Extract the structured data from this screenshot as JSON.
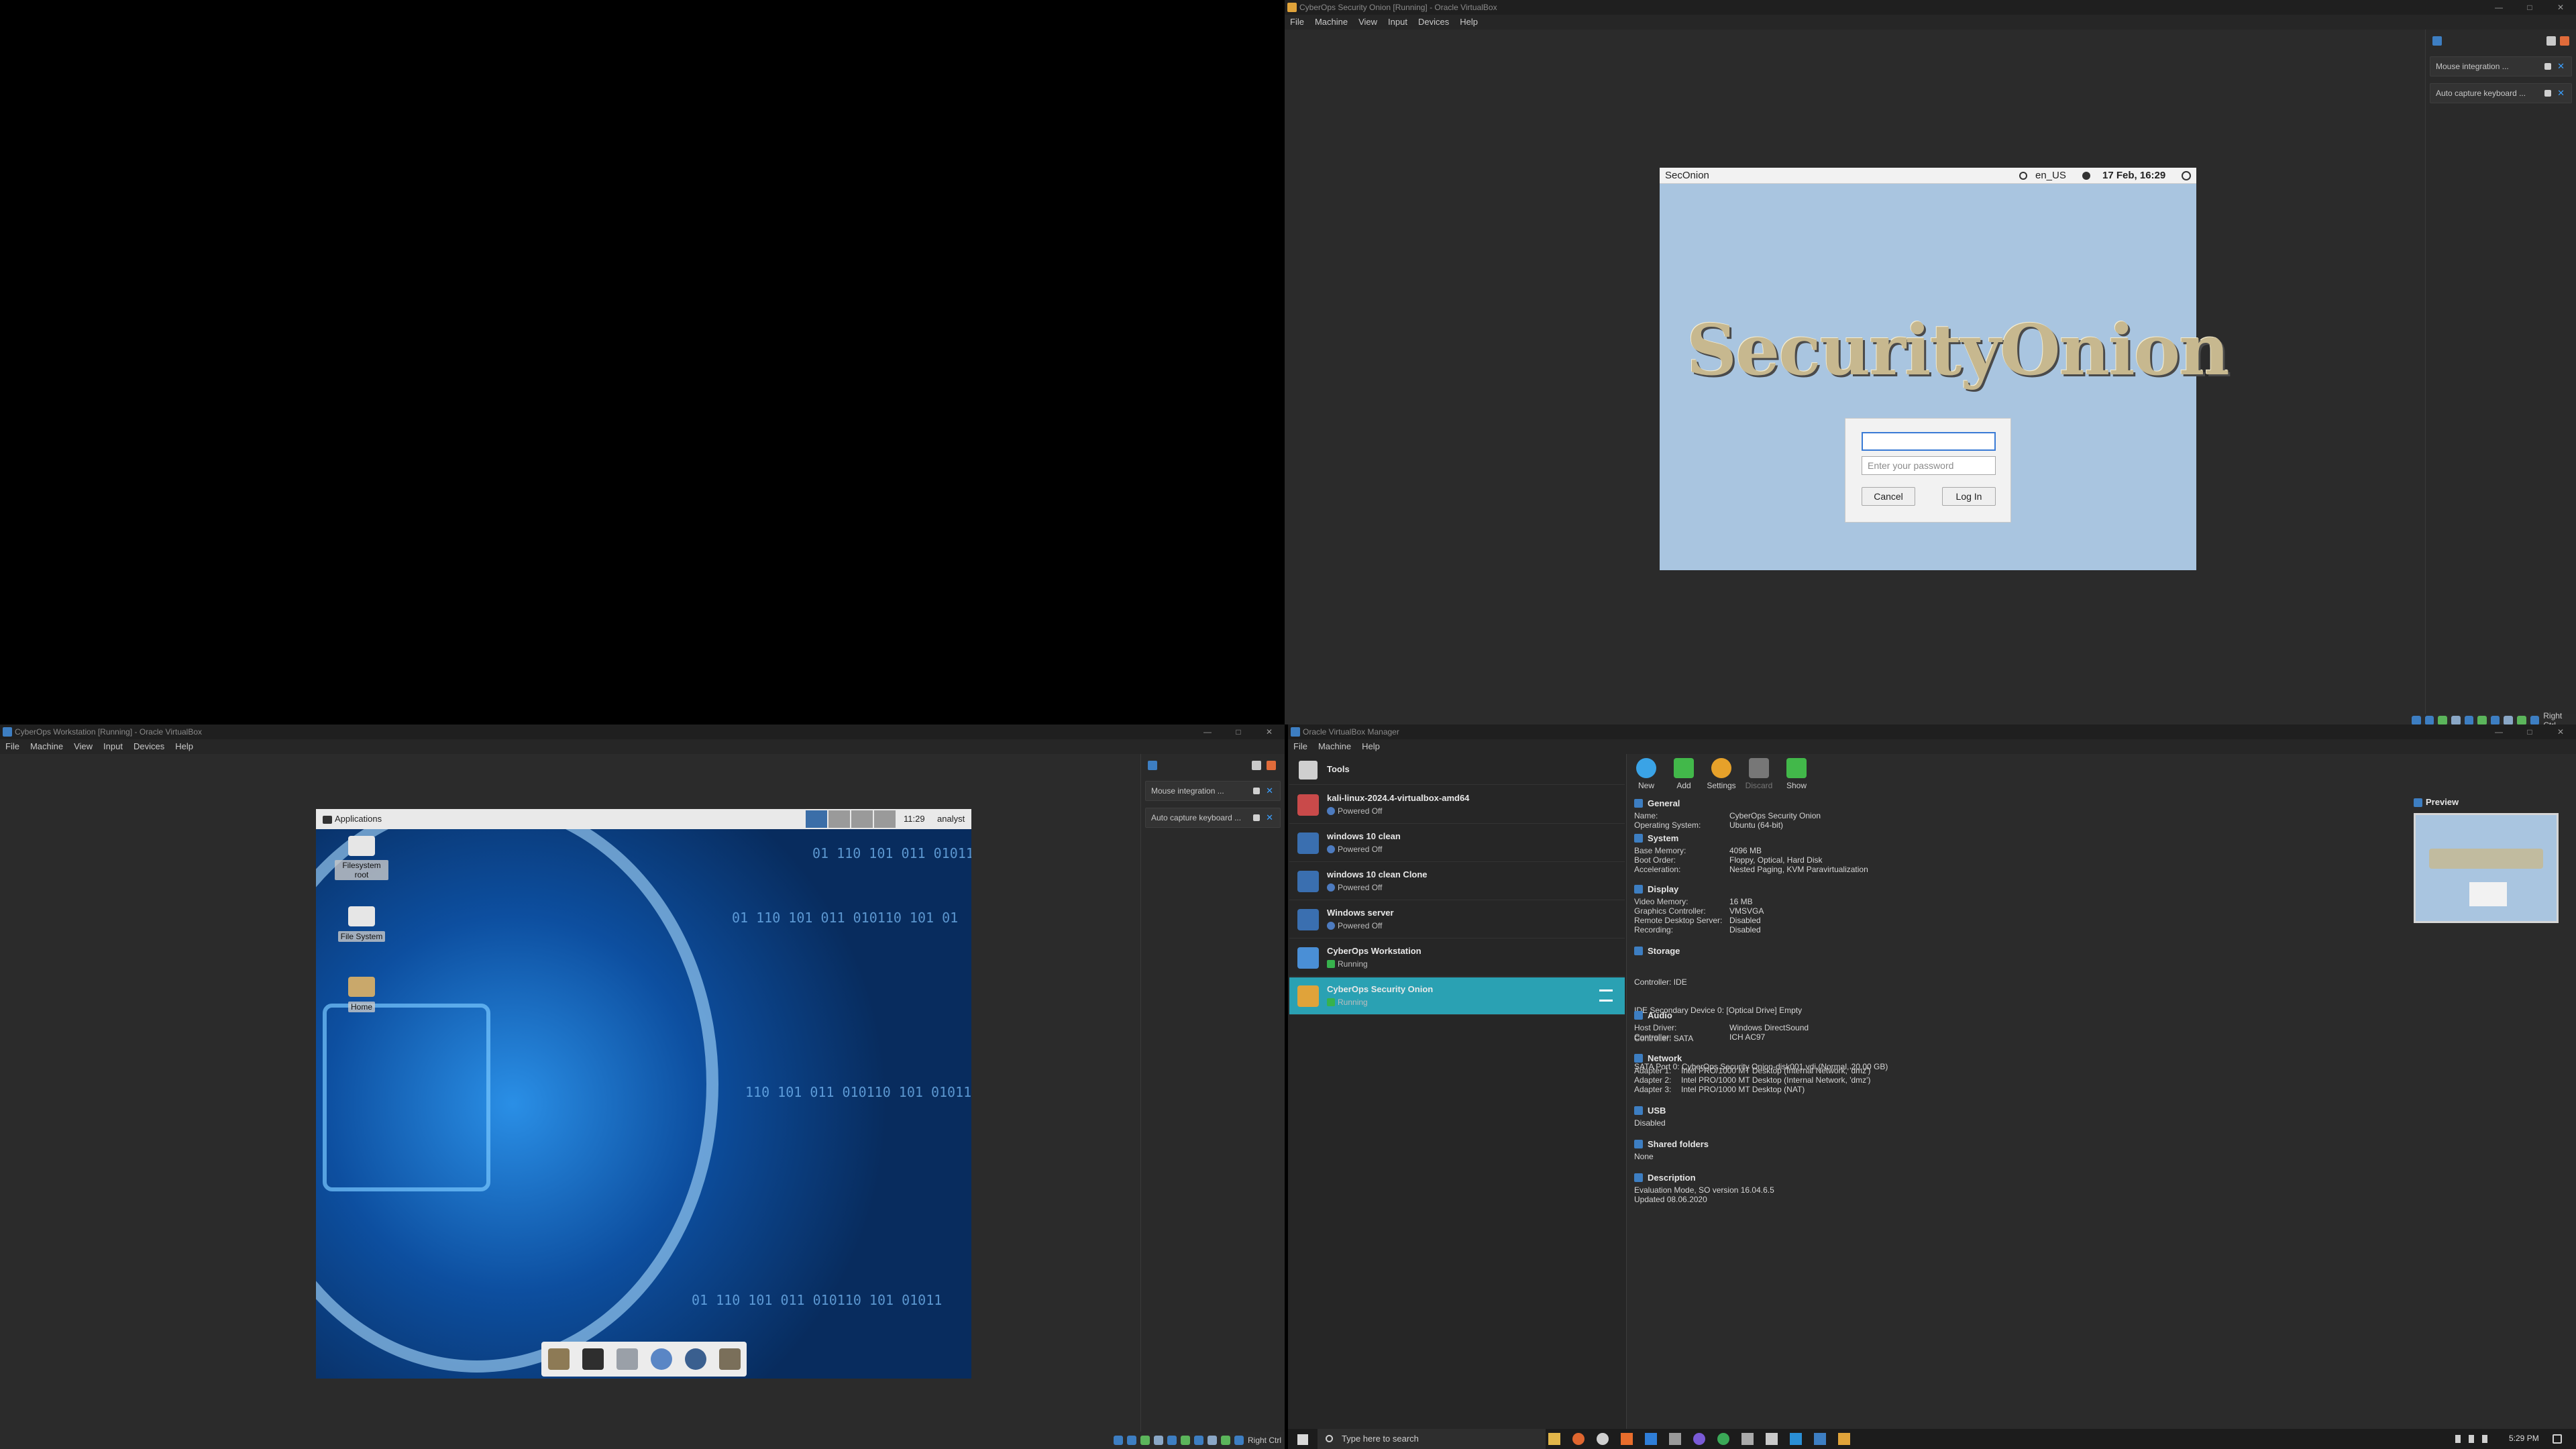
{
  "so_window": {
    "title": "CyberOps Security Onion [Running] - Oracle VirtualBox",
    "menu": [
      "File",
      "Machine",
      "View",
      "Input",
      "Devices",
      "Help"
    ],
    "panel_items": [
      "Mouse integration ...",
      "Auto capture keyboard ..."
    ],
    "right_ctrl": "Right Ctrl",
    "guest": {
      "topbar_left": "SecOnion",
      "locale": "en_US",
      "datetime": "17 Feb, 16:29",
      "logo_text": "SecurityOnion",
      "username_value": "",
      "password_placeholder": "Enter your password",
      "cancel_label": "Cancel",
      "login_label": "Log In"
    }
  },
  "ws_window": {
    "title": "CyberOps Workstation [Running] - Oracle VirtualBox",
    "menu": [
      "File",
      "Machine",
      "View",
      "Input",
      "Devices",
      "Help"
    ],
    "panel_items": [
      "Mouse integration ...",
      "Auto capture keyboard ..."
    ],
    "right_ctrl": "Right Ctrl",
    "guest": {
      "apps_label": "Applications",
      "clock": "11:29",
      "user": "analyst",
      "desktop_icons": [
        "Filesystem root",
        "File System",
        "Home"
      ]
    }
  },
  "manager": {
    "title": "Oracle VirtualBox Manager",
    "menu": [
      "File",
      "Machine",
      "Help"
    ],
    "tools_label": "Tools",
    "toolbar": [
      "New",
      "Add",
      "Settings",
      "Discard",
      "Show"
    ],
    "vms": [
      {
        "name": "kali-linux-2024.4-virtualbox-amd64",
        "state": "Powered Off"
      },
      {
        "name": "windows 10 clean",
        "state": "Powered Off"
      },
      {
        "name": "windows 10 clean Clone",
        "state": "Powered Off"
      },
      {
        "name": "Windows server",
        "state": "Powered Off"
      },
      {
        "name": "CyberOps Workstation",
        "state": "Running"
      },
      {
        "name": "CyberOps Security Onion",
        "state": "Running"
      }
    ],
    "preview_label": "Preview",
    "details": {
      "general": {
        "header": "General",
        "rows": [
          [
            "Name:",
            "CyberOps Security Onion"
          ],
          [
            "Operating System:",
            "Ubuntu (64-bit)"
          ]
        ]
      },
      "system": {
        "header": "System",
        "rows": [
          [
            "Base Memory:",
            "4096 MB"
          ],
          [
            "Boot Order:",
            "Floppy, Optical, Hard Disk"
          ],
          [
            "Acceleration:",
            "Nested Paging, KVM Paravirtualization"
          ]
        ]
      },
      "display": {
        "header": "Display",
        "rows": [
          [
            "Video Memory:",
            "16 MB"
          ],
          [
            "Graphics Controller:",
            "VMSVGA"
          ],
          [
            "Remote Desktop Server:",
            "Disabled"
          ],
          [
            "Recording:",
            "Disabled"
          ]
        ]
      },
      "storage": {
        "header": "Storage",
        "lines": [
          "Controller: IDE",
          " IDE Secondary Device 0:   [Optical Drive] Empty",
          "Controller: SATA",
          " SATA Port 0:                    CyberOps Security Onion-disk001.vdi (Normal, 20.00 GB)"
        ]
      },
      "audio": {
        "header": "Audio",
        "rows": [
          [
            "Host Driver:",
            "Windows DirectSound"
          ],
          [
            "Controller:",
            "ICH AC97"
          ]
        ]
      },
      "network": {
        "header": "Network",
        "rows": [
          [
            "Adapter 1:",
            "Intel PRO/1000 MT Desktop (Internal Network, 'dmz')"
          ],
          [
            "Adapter 2:",
            "Intel PRO/1000 MT Desktop (Internal Network, 'dmz')"
          ],
          [
            "Adapter 3:",
            "Intel PRO/1000 MT Desktop (NAT)"
          ]
        ]
      },
      "usb": {
        "header": "USB",
        "value": "Disabled"
      },
      "shared": {
        "header": "Shared folders",
        "value": "None"
      },
      "description": {
        "header": "Description",
        "lines": [
          "Evaluation Mode, SO version 16.04.6.5",
          "Updated 08.06.2020"
        ]
      }
    }
  },
  "taskbar": {
    "search_placeholder": "Type here to search",
    "time": "5:29 PM"
  }
}
